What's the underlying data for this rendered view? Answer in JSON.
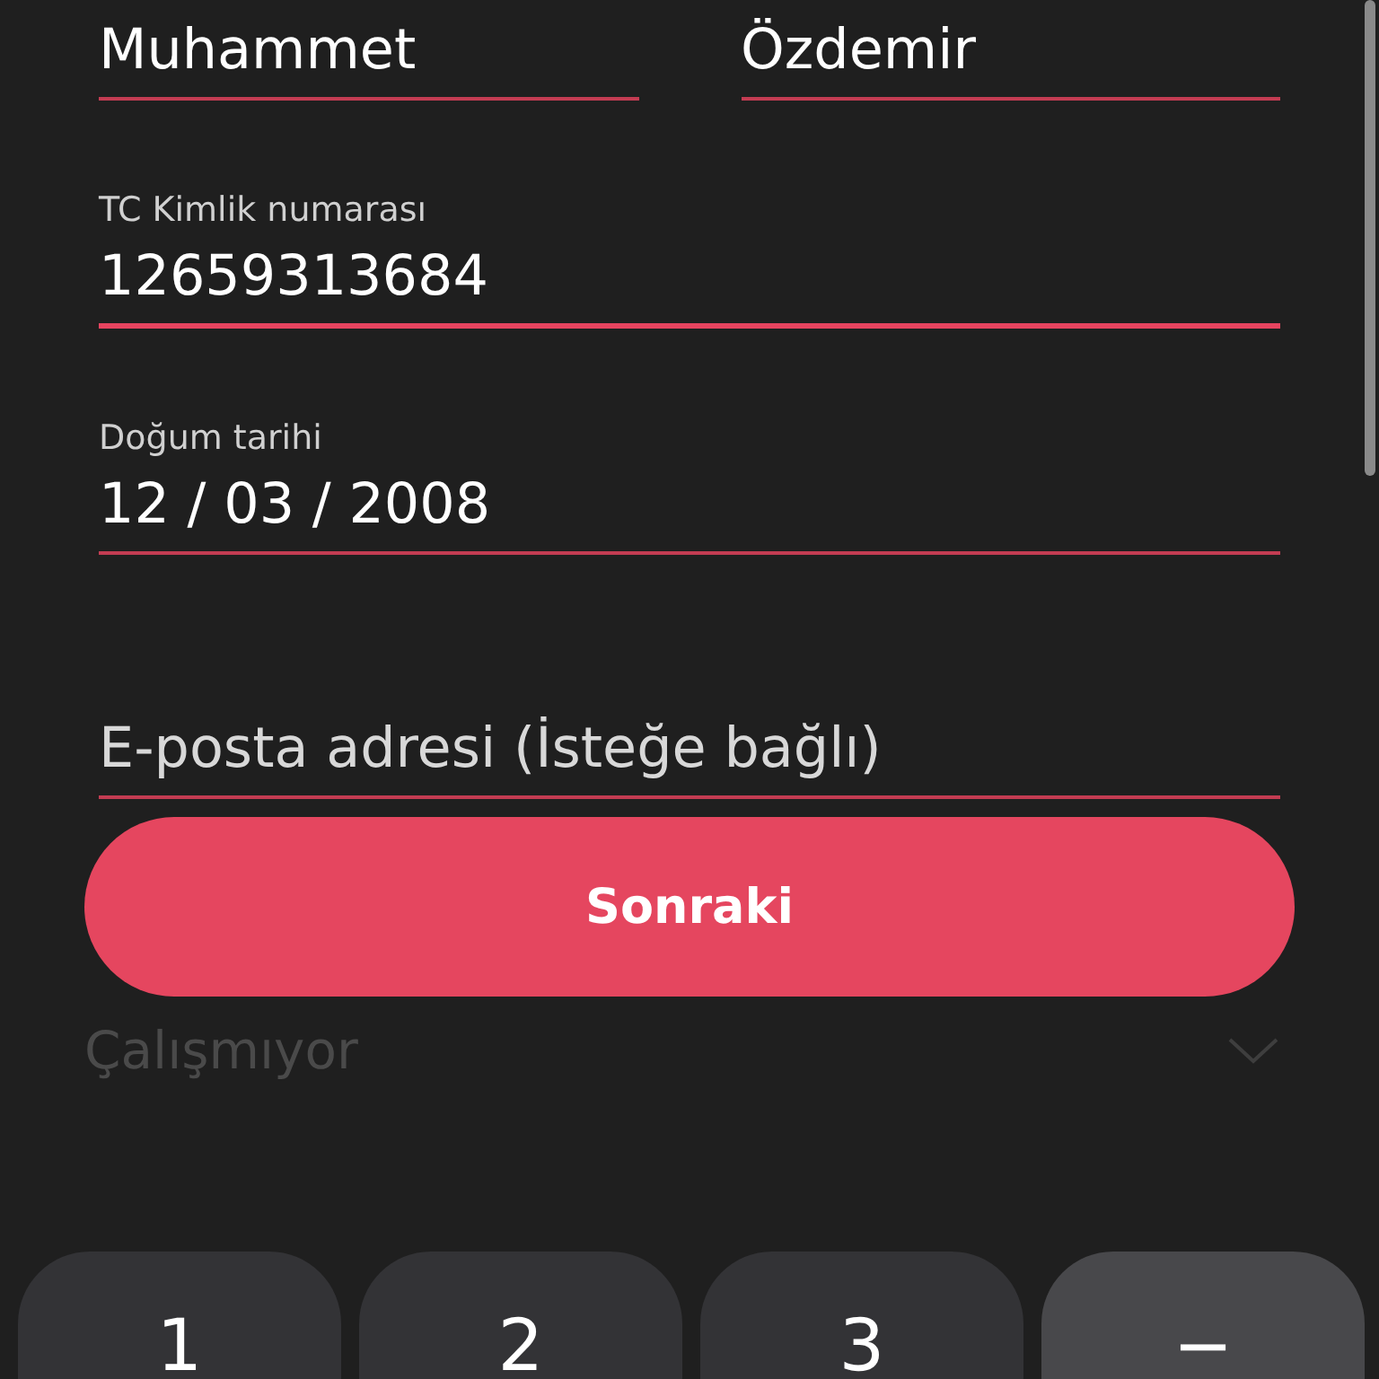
{
  "name_fields": [
    {
      "value": "Muhammet"
    },
    {
      "value": "Özdemir"
    }
  ],
  "fields": [
    {
      "label": "TC Kimlik numarası",
      "value": "12659313684",
      "focused": true
    },
    {
      "label": "Doğum tarihi",
      "value": "12 / 03 / 2008",
      "focused": false
    },
    {
      "placeholder": "E-posta adresi (İsteğe bağlı)",
      "focused": false
    }
  ],
  "next_button": "Sonraki",
  "dropdown": {
    "value": "Çalışmıyor"
  },
  "keypad": [
    {
      "label": "1",
      "kind": "digit"
    },
    {
      "label": "2",
      "kind": "digit"
    },
    {
      "label": "3",
      "kind": "digit"
    },
    {
      "label": "−",
      "kind": "symbol"
    }
  ]
}
